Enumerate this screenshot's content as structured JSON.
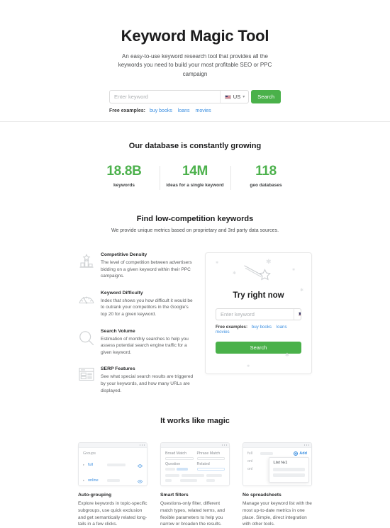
{
  "colors": {
    "accent_green": "#4ab14a",
    "stat_green": "#4cb14c",
    "link_blue": "#3a8ee0",
    "text_dark": "#222324",
    "text_muted": "#5b5d5f",
    "icon_grey": "#cfd2d4"
  },
  "hero": {
    "title": "Keyword Magic Tool",
    "subtitle": "An easy-to-use keyword research tool that provides all the keywords you need to build your most profitable SEO or PPC campaign",
    "search": {
      "placeholder": "Enter keyword",
      "value": "",
      "country": "US",
      "country_flag": "us-flag-icon",
      "button_label": "Search"
    },
    "examples": {
      "label": "Free examples:",
      "links": [
        "buy books",
        "loans",
        "movies"
      ]
    }
  },
  "stats": {
    "heading": "Our database is constantly growing",
    "items": [
      {
        "value": "18.8B",
        "label": "keywords"
      },
      {
        "value": "14M",
        "label": "ideas for a single keyword"
      },
      {
        "value": "118",
        "label": "geo databases"
      }
    ]
  },
  "find": {
    "heading": "Find low-competition keywords",
    "subheading": "We provide unique metrics based on proprietary and 3rd party data sources.",
    "features": [
      {
        "icon": "competitive-density-icon",
        "title": "Competitive Density",
        "text": "The level of competition between advertisers bidding on a given keyword within their PPC campaigns."
      },
      {
        "icon": "keyword-difficulty-gauge-icon",
        "title": "Keyword Difficulty",
        "text": "Index that shows you how difficult it would be to outrank your competitors in the Google's top 20 for a given keyword."
      },
      {
        "icon": "search-volume-magnifier-icon",
        "title": "Search Volume",
        "text": "Estimation of monthly searches to help you assess potential search engine traffic for a given keyword."
      },
      {
        "icon": "serp-features-layout-icon",
        "title": "SERP Features",
        "text": "See what special search results are triggered by your keywords, and how many URLs are displayed."
      }
    ],
    "try_card": {
      "illustration": "magic-wand-icon",
      "title": "Try right now",
      "search": {
        "placeholder": "Enter keyword",
        "value": "",
        "country": "US",
        "button_label": "Search"
      },
      "examples": {
        "label": "Free examples:",
        "links": [
          "buy books",
          "loans",
          "movies"
        ]
      }
    }
  },
  "magic": {
    "heading": "It works like magic",
    "cards": [
      {
        "mock": {
          "type": "groups-panel",
          "header": "Groups",
          "rows": [
            {
              "name": "full",
              "masked": false
            },
            {
              "name": "online",
              "masked": false
            },
            {
              "name": "",
              "masked": true
            }
          ],
          "row_action_icon": "eye-icon"
        },
        "title": "Auto-grouping",
        "text": "Explore keywords in topic-specific subgroups, use quick exclusion and get semantically related long-tails in a few clicks."
      },
      {
        "mock": {
          "type": "filters-panel",
          "labels": [
            "Broad Match",
            "Phrase Match",
            "Question",
            "Related"
          ]
        },
        "title": "Smart filters",
        "text": "Questions-only filter, different match types, related terms, and flexible parameters to help you narrow or broaden the results."
      },
      {
        "mock": {
          "type": "keyword-list-panel",
          "rows": [
            "full",
            "onl",
            "onl"
          ],
          "add_label": "Add",
          "add_icon": "plus-circle-icon",
          "popover_title": "List №1"
        },
        "title": "No spreadsheets",
        "text": "Manage your keyword list with the most up-to-date metrics in one place. Simple, direct integration with other tools."
      }
    ]
  }
}
